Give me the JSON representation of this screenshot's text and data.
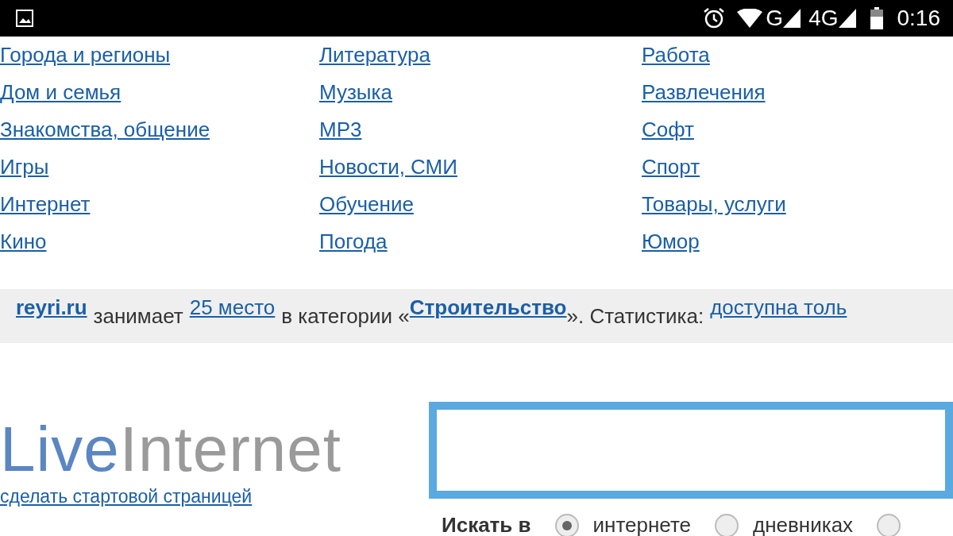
{
  "status_bar": {
    "network_1": "G",
    "network_2": "4G",
    "time": "0:16"
  },
  "categories": [
    {
      "links": [
        "Города и регионы",
        "Дом и семья",
        "Знакомства, общение",
        "Игры",
        "Интернет",
        "Кино"
      ]
    },
    {
      "links": [
        "Литература",
        "Музыка",
        "MP3",
        "Новости, СМИ",
        "Обучение",
        "Погода"
      ]
    },
    {
      "links": [
        "Работа",
        "Развлечения",
        "Софт",
        "Спорт",
        "Товары, услуги",
        "Юмор"
      ]
    }
  ],
  "rating": {
    "site": "reyri.ru",
    "text_1": "занимает",
    "place": "25 место",
    "text_2": "в категории «",
    "category": "Строительство",
    "text_3": "». Статистика:",
    "stats_link": "доступна толь"
  },
  "logo": {
    "part_1": "Live",
    "part_2": "Internet"
  },
  "start_page_link": "сделать стартовой страницей",
  "search": {
    "label": "Искать в",
    "options": [
      {
        "label": "интернете",
        "selected": true
      },
      {
        "label": "дневниках",
        "selected": false
      },
      {
        "selected": false
      }
    ]
  }
}
